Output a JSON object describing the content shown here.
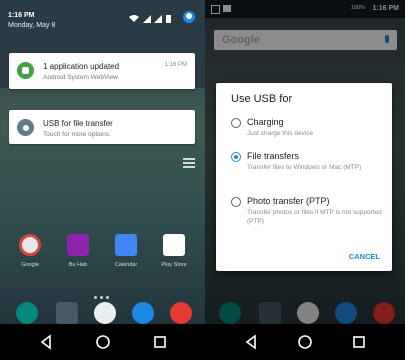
{
  "left_screen": {
    "status_bar": {
      "time": "1:16 PM",
      "date": "Monday, May 8"
    },
    "notifications": [
      {
        "title": "1 application updated",
        "subtitle": "Android System WebView",
        "time": "1:16 PM"
      },
      {
        "title": "USB for file transfer",
        "subtitle": "Touch for more options."
      }
    ],
    "apps": [
      {
        "label": "Google",
        "color": "#e0e0e0"
      },
      {
        "label": "Bu Hab",
        "color": "#8e24aa"
      },
      {
        "label": "Calendar",
        "color": "#4285f4"
      },
      {
        "label": "Play Store",
        "color": "#ffffff"
      }
    ],
    "dock_icons": [
      "phone-icon",
      "camera-icon",
      "app-drawer-icon",
      "messages-icon",
      "browser-icon"
    ]
  },
  "right_screen": {
    "status_bar": {
      "time": "1:16 PM",
      "battery": "100%"
    },
    "search": {
      "placeholder": "Google"
    },
    "dialog": {
      "title": "Use USB for",
      "options": [
        {
          "title": "Charging",
          "description": "Just charge this device",
          "selected": false
        },
        {
          "title": "File transfers",
          "description": "Transfer files to Windows or Mac (MTP)",
          "selected": true
        },
        {
          "title": "Photo transfer (PTP)",
          "description": "Transfer photos or files if MTP is not supported (PTP)",
          "selected": false
        }
      ],
      "cancel_label": "CANCEL"
    }
  },
  "navigation": {
    "buttons": [
      "back-icon",
      "home-icon",
      "recents-icon"
    ]
  },
  "colors": {
    "accent": "#1e88e5",
    "notification_icon_green": "#43a047"
  }
}
